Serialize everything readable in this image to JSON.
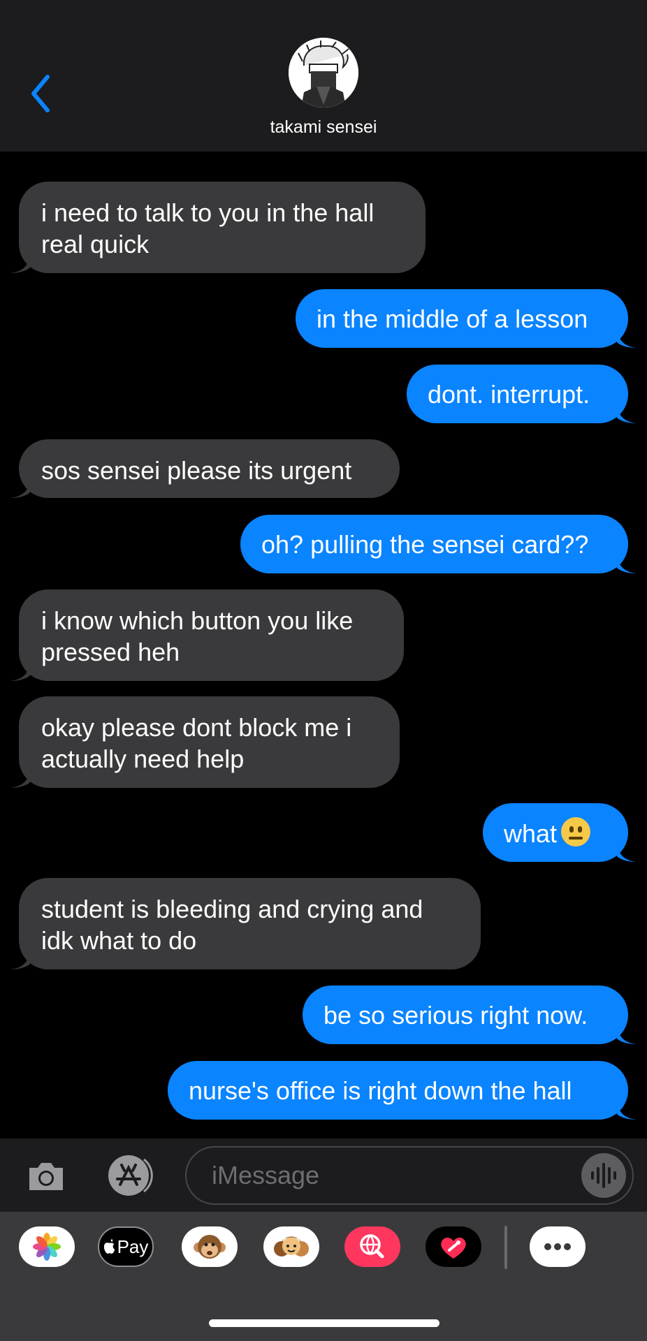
{
  "header": {
    "contact_name": "takami sensei",
    "back_icon": "chevron-left-icon",
    "accent": "#0a84ff"
  },
  "messages": [
    {
      "from": "them",
      "text": "i need to talk to you in the hall\nreal quick"
    },
    {
      "from": "me",
      "text": "in the middle of a lesson"
    },
    {
      "from": "me",
      "text": "dont. interrupt."
    },
    {
      "from": "them",
      "text": "sos sensei please its urgent"
    },
    {
      "from": "me",
      "text": "oh? pulling the sensei card??"
    },
    {
      "from": "them",
      "text": "i know which button you like\npressed heh"
    },
    {
      "from": "them",
      "text": "okay please dont block me i\nactually need help"
    },
    {
      "from": "me",
      "text": "what",
      "emoji": "neutral-face-emoji"
    },
    {
      "from": "them",
      "text": "student is bleeding and crying and\nidk what to do"
    },
    {
      "from": "me",
      "text": "be so serious right now."
    },
    {
      "from": "me",
      "text": "nurse's office is right down the hall"
    }
  ],
  "input": {
    "placeholder": "iMessage"
  },
  "apps": {
    "apple_pay_label": "Pay"
  },
  "colors": {
    "incoming_bubble": "#3a3a3c",
    "outgoing_bubble": "#0a84ff",
    "background": "#000000"
  }
}
